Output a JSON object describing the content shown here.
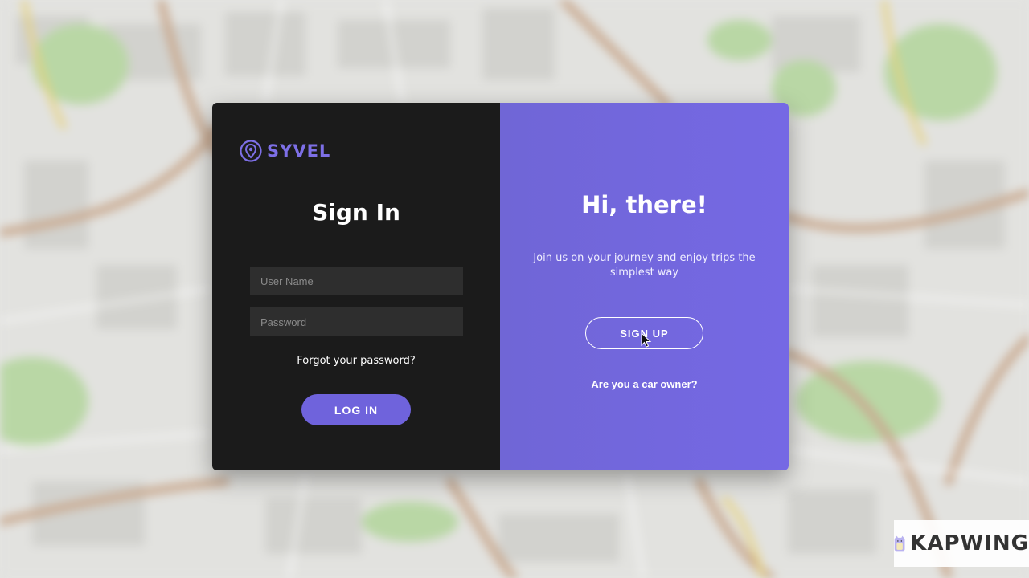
{
  "brand": {
    "name": "SYVEL",
    "accent_color": "#6f63dc",
    "logo_icon": "map-pin-icon"
  },
  "signin": {
    "title": "Sign In",
    "username_placeholder": "User Name",
    "password_placeholder": "Password",
    "forgot_label": "Forgot your password?",
    "login_label": "LOG IN"
  },
  "signup_panel": {
    "title": "Hi, there!",
    "tagline": "Join us on your journey and enjoy trips the simplest way",
    "signup_label": "SIGN UP",
    "car_owner_label": "Are you a car owner?"
  },
  "watermark": {
    "text": "KAPWING"
  },
  "colors": {
    "left_panel": "#1b1b1b",
    "right_panel": "#7568e4",
    "field_bg": "#2e2e2e"
  }
}
